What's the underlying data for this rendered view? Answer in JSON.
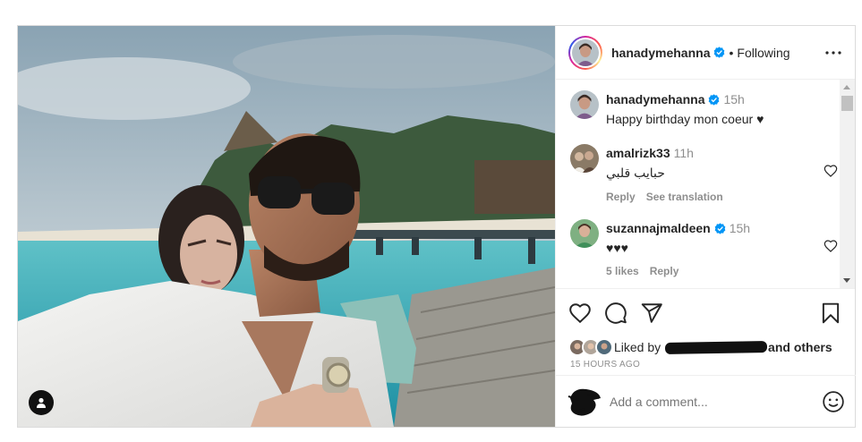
{
  "post": {
    "author": {
      "username": "hanadymehanna",
      "verified": true,
      "follow_status": "Following",
      "separator": "•"
    },
    "caption": {
      "username": "hanadymehanna",
      "time": "15h",
      "text": "Happy birthday mon coeur ♥"
    },
    "comments": [
      {
        "username": "amalrizk33",
        "verified": false,
        "time": "11h",
        "text": "حبايب قلبي",
        "likes": "",
        "reply_label": "Reply",
        "translate_label": "See translation"
      },
      {
        "username": "suzannajmaldeen",
        "verified": true,
        "time": "15h",
        "text": "♥♥♥",
        "likes": "5 likes",
        "reply_label": "Reply",
        "translate_label": ""
      }
    ],
    "likes": {
      "prefix": "Liked by",
      "suffix": "and others"
    },
    "timestamp": "15 HOURS AGO",
    "add_comment_placeholder": "Add a comment..."
  },
  "icons": {
    "more": "more-horizontal-icon",
    "like": "heart-icon",
    "comment": "comment-icon",
    "share": "send-icon",
    "save": "bookmark-icon",
    "emoji": "emoji-icon",
    "tag": "user-tag-icon",
    "verified": "verified-badge-icon"
  },
  "colors": {
    "verified": "#0095f6",
    "muted_text": "#8e8e8e",
    "border": "#dbdbdb"
  }
}
